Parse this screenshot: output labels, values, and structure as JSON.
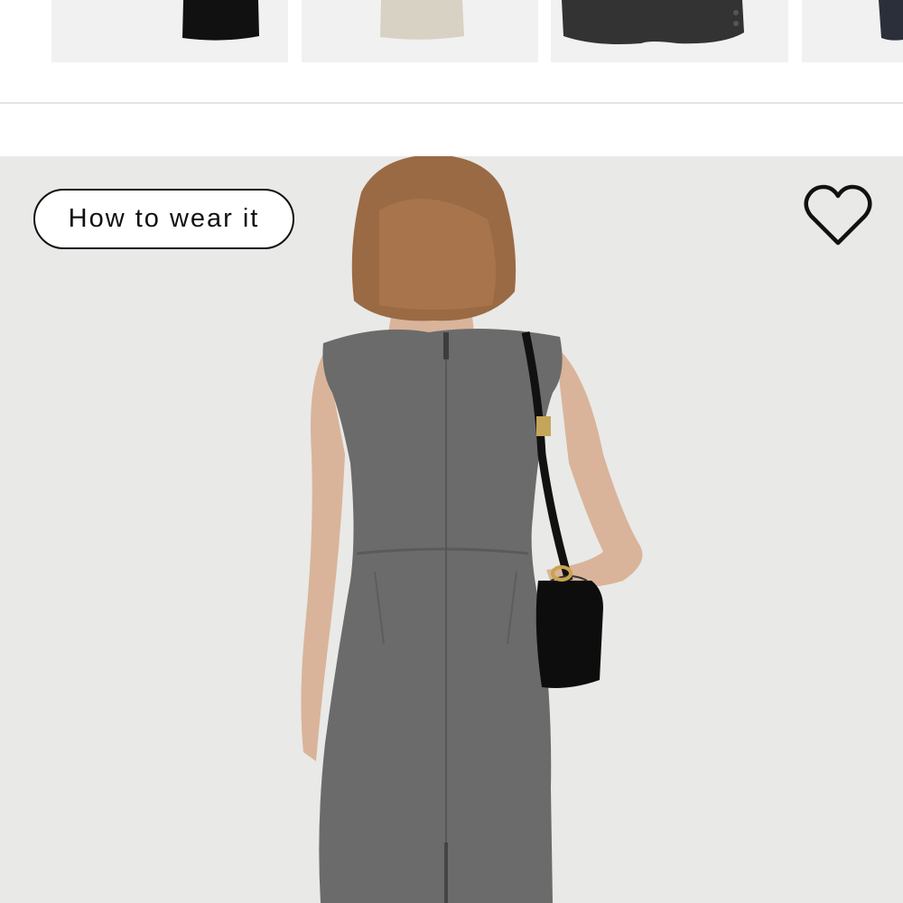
{
  "thumbnails": [
    {
      "icon": "black-skirt-thumbnail"
    },
    {
      "icon": "beige-skirt-thumbnail"
    },
    {
      "icon": "charcoal-blazer-thumbnail"
    },
    {
      "icon": "navy-item-thumbnail"
    }
  ],
  "hero": {
    "how_to_wear_label": "How to wear it",
    "wishlist_icon": "heart-icon",
    "image_icon": "model-grey-sheath-dress-back-view"
  },
  "colors": {
    "background": "#ffffff",
    "image_bg": "#e9e9e7",
    "pill_border": "#111111",
    "dress": "#6b6b6b"
  }
}
